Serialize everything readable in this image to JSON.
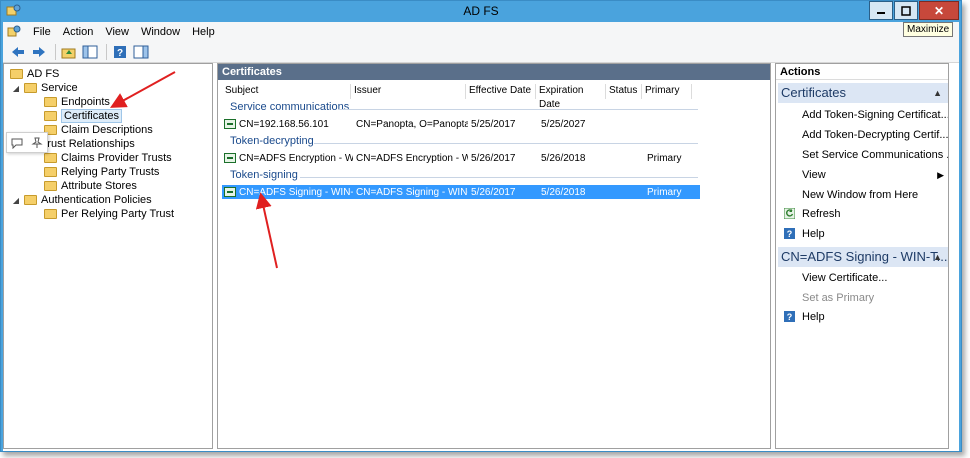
{
  "window": {
    "title": "AD FS"
  },
  "tooltip": "Maximize",
  "menu": [
    "File",
    "Action",
    "View",
    "Window",
    "Help"
  ],
  "tree": {
    "items": [
      {
        "label": "AD FS",
        "level": 0,
        "expander": ""
      },
      {
        "label": "Service",
        "level": 1,
        "expander": "◢"
      },
      {
        "label": "Endpoints",
        "level": 2,
        "expander": ""
      },
      {
        "label": "Certificates",
        "level": 2,
        "expander": "",
        "selected": true
      },
      {
        "label": "Claim Descriptions",
        "level": 2,
        "expander": ""
      },
      {
        "label": "Trust Relationships",
        "level": 1,
        "expander": "◢"
      },
      {
        "label": "Claims Provider Trusts",
        "level": 2,
        "expander": ""
      },
      {
        "label": "Relying Party Trusts",
        "level": 2,
        "expander": ""
      },
      {
        "label": "Attribute Stores",
        "level": 2,
        "expander": ""
      },
      {
        "label": "Authentication Policies",
        "level": 1,
        "expander": "◢"
      },
      {
        "label": "Per Relying Party Trust",
        "level": 2,
        "expander": ""
      }
    ]
  },
  "center": {
    "header": "Certificates",
    "columns": [
      "Subject",
      "Issuer",
      "Effective Date",
      "Expiration Date",
      "Status",
      "Primary"
    ],
    "groups": [
      {
        "label": "Service communications",
        "rows": [
          {
            "subject": "CN=192.168.56.101",
            "issuer": "CN=Panopta, O=Panopta,...",
            "effective": "5/25/2017",
            "expiration": "5/25/2027",
            "status": "",
            "primary": ""
          }
        ]
      },
      {
        "label": "Token-decrypting",
        "rows": [
          {
            "subject": "CN=ADFS Encryption - WI...",
            "issuer": "CN=ADFS Encryption - W...",
            "effective": "5/26/2017",
            "expiration": "5/26/2018",
            "status": "",
            "primary": "Primary"
          }
        ]
      },
      {
        "label": "Token-signing",
        "rows": [
          {
            "subject": "CN=ADFS Signing - WIN-T...",
            "issuer": "CN=ADFS Signing - WIN-...",
            "effective": "5/26/2017",
            "expiration": "5/26/2018",
            "status": "",
            "primary": "Primary",
            "selected": true
          }
        ]
      }
    ]
  },
  "actions": {
    "header": "Actions",
    "section1": {
      "title": "Certificates",
      "items": [
        {
          "label": "Add Token-Signing Certificat...",
          "icon": ""
        },
        {
          "label": "Add Token-Decrypting Certif...",
          "icon": ""
        },
        {
          "label": "Set Service Communications ...",
          "icon": ""
        },
        {
          "label": "View",
          "icon": "",
          "submenu": "▶"
        },
        {
          "label": "New Window from Here",
          "icon": ""
        },
        {
          "label": "Refresh",
          "icon": "refresh-icon"
        },
        {
          "label": "Help",
          "icon": "help-icon"
        }
      ]
    },
    "section2": {
      "title": "CN=ADFS Signing - WIN-T...",
      "items": [
        {
          "label": "View Certificate...",
          "icon": ""
        },
        {
          "label": "Set as Primary",
          "icon": "",
          "disabled": true
        },
        {
          "label": "Help",
          "icon": "help-icon"
        }
      ]
    }
  },
  "colors": {
    "titlebar": "#4aa3dd",
    "selection": "#3399ff",
    "annotation_arrow": "#e02020",
    "pane_header": "#5a6f8a"
  }
}
